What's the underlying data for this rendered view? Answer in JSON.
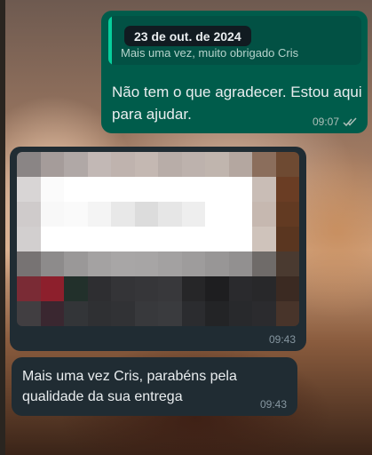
{
  "date_separator": "23 de out. de 2024",
  "messages": [
    {
      "direction": "outgoing",
      "quoted_text": "Mais uma vez, muito obrigado Cris",
      "text": "Não tem o que agradecer. Estou aqui para ajudar.",
      "time": "09:07",
      "status": "read"
    },
    {
      "direction": "incoming",
      "type": "image",
      "image_state": "pixelated",
      "time": "09:43"
    },
    {
      "direction": "incoming",
      "text": "Mais uma vez Cris, parabéns pela qualidade da sua entrega",
      "time": "09:43"
    }
  ],
  "colors": {
    "outgoing_bubble": "#005c4b",
    "incoming_bubble": "#202c33",
    "quote_accent": "#06cf9c",
    "read_ticks": "#53bdeb"
  }
}
